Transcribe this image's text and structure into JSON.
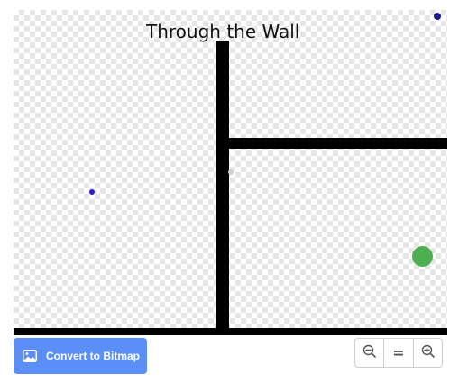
{
  "stage": {
    "title": "Through the Wall"
  },
  "controls": {
    "convert_label": "Convert to Bitmap",
    "convert_icon": "image-icon",
    "zoom_out_icon": "zoom-out-icon",
    "zoom_reset_icon": "equals-icon",
    "zoom_in_icon": "zoom-in-icon"
  },
  "colors": {
    "accent": "#5c8ef7",
    "wall": "#000000",
    "ball": "#4caf50"
  }
}
